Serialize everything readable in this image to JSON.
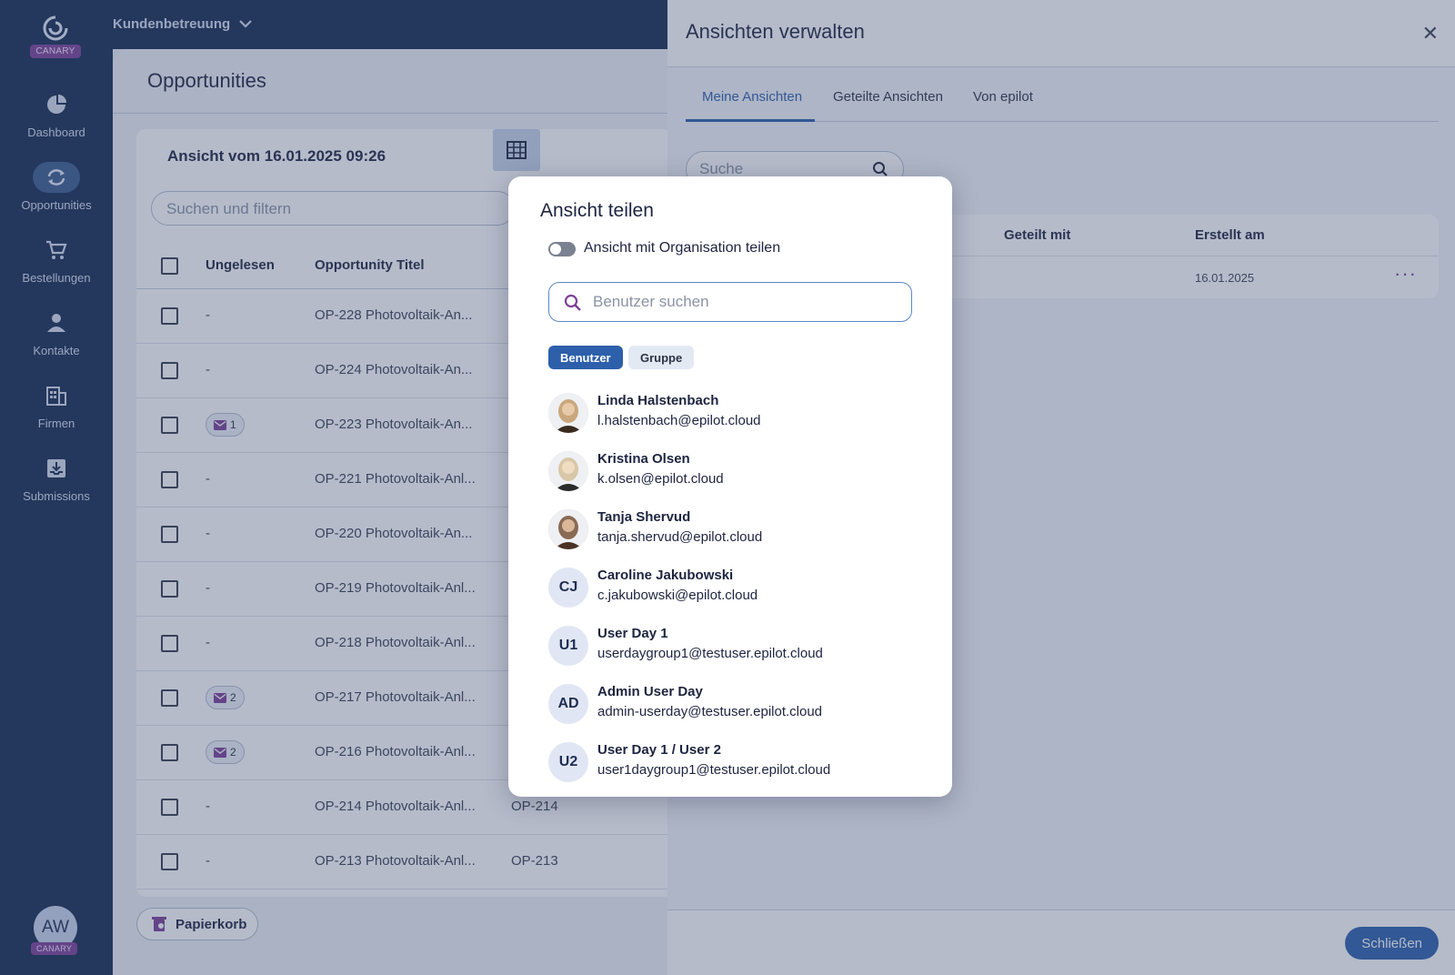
{
  "sidebar": {
    "badge": "CANARY",
    "items": [
      {
        "label": "Dashboard",
        "icon": "pie-chart-icon"
      },
      {
        "label": "Opportunities",
        "icon": "sync-icon"
      },
      {
        "label": "Bestellungen",
        "icon": "cart-icon"
      },
      {
        "label": "Kontakte",
        "icon": "person-icon"
      },
      {
        "label": "Firmen",
        "icon": "building-icon"
      },
      {
        "label": "Submissions",
        "icon": "inbox-icon"
      }
    ],
    "user_initials": "AW"
  },
  "topbar": {
    "workspace": "Kundenbetreuung"
  },
  "main": {
    "title": "Opportunities",
    "view_title": "Ansicht vom 16.01.2025 09:26",
    "filter_placeholder": "Suchen und filtern",
    "columns": [
      "Ungelesen",
      "Opportunity Titel"
    ],
    "rows": [
      {
        "unread": "-",
        "title": "OP-228 Photovoltaik-An...",
        "num": ""
      },
      {
        "unread": "-",
        "title": "OP-224 Photovoltaik-An...",
        "num": ""
      },
      {
        "unread": "1",
        "title": "OP-223 Photovoltaik-An...",
        "num": ""
      },
      {
        "unread": "-",
        "title": "OP-221 Photovoltaik-Anl...",
        "num": ""
      },
      {
        "unread": "-",
        "title": "OP-220 Photovoltaik-An...",
        "num": ""
      },
      {
        "unread": "-",
        "title": "OP-219 Photovoltaik-Anl...",
        "num": ""
      },
      {
        "unread": "-",
        "title": "OP-218 Photovoltaik-Anl...",
        "num": ""
      },
      {
        "unread": "2",
        "title": "OP-217 Photovoltaik-Anl...",
        "num": ""
      },
      {
        "unread": "2",
        "title": "OP-216 Photovoltaik-Anl...",
        "num": ""
      },
      {
        "unread": "-",
        "title": "OP-214 Photovoltaik-Anl...",
        "num": "OP-214"
      },
      {
        "unread": "-",
        "title": "OP-213 Photovoltaik-Anl...",
        "num": "OP-213"
      }
    ],
    "trash_label": "Papierkorb"
  },
  "panel": {
    "title": "Ansichten verwalten",
    "tabs": [
      "Meine Ansichten",
      "Geteilte Ansichten",
      "Von epilot"
    ],
    "search_placeholder": "Suche",
    "columns": [
      "Geteilt mit",
      "Erstellt am"
    ],
    "row": {
      "created": "16.01.2025"
    },
    "close_label": "Schließen"
  },
  "modal": {
    "title": "Ansicht teilen",
    "toggle_label": "Ansicht mit Organisation teilen",
    "search_placeholder": "Benutzer suchen",
    "chips": [
      "Benutzer",
      "Gruppe"
    ],
    "users": [
      {
        "name": "Linda Halstenbach",
        "email": "l.halstenbach@epilot.cloud",
        "initials": ""
      },
      {
        "name": "Kristina Olsen",
        "email": "k.olsen@epilot.cloud",
        "initials": ""
      },
      {
        "name": "Tanja Shervud",
        "email": "tanja.shervud@epilot.cloud",
        "initials": ""
      },
      {
        "name": "Caroline Jakubowski",
        "email": "c.jakubowski@epilot.cloud",
        "initials": "CJ"
      },
      {
        "name": "User Day 1",
        "email": "userdaygroup1@testuser.epilot.cloud",
        "initials": "U1"
      },
      {
        "name": "Admin User Day",
        "email": "admin-userday@testuser.epilot.cloud",
        "initials": "AD"
      },
      {
        "name": "User Day 1 / User 2",
        "email": "user1daygroup1@testuser.epilot.cloud",
        "initials": "U2"
      }
    ]
  },
  "colors": {
    "sidebar": "#152b52",
    "accent": "#2d5fab",
    "canary": "#7d3f98"
  }
}
